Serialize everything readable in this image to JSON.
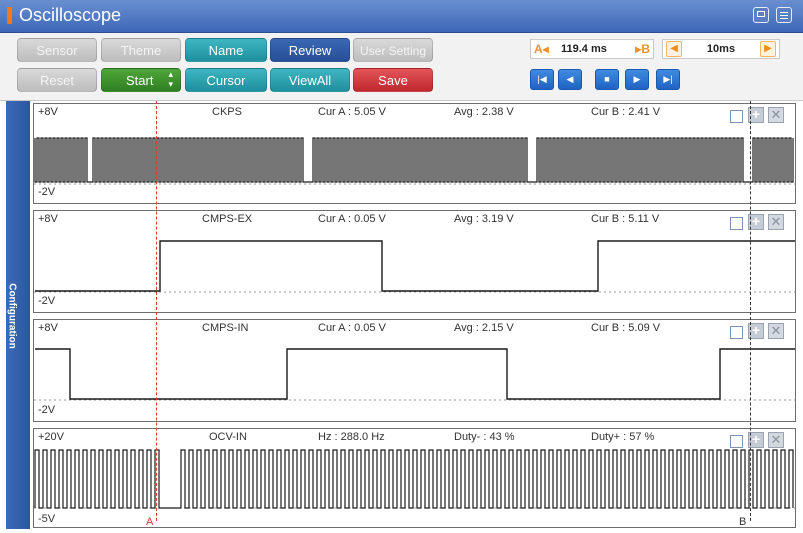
{
  "app": {
    "title": "Oscilloscope"
  },
  "toolbar": {
    "row1": [
      {
        "label": "Sensor",
        "style": "gray"
      },
      {
        "label": "Theme",
        "style": "gray"
      },
      {
        "label": "Name",
        "style": "teal"
      },
      {
        "label": "Review",
        "style": "blue"
      },
      {
        "label": "User Setting",
        "style": "gray"
      }
    ],
    "row2": [
      {
        "label": "Reset",
        "style": "gray"
      },
      {
        "label": "Start",
        "style": "green"
      },
      {
        "label": "Cursor",
        "style": "teal"
      },
      {
        "label": "ViewAll",
        "style": "teal"
      },
      {
        "label": "Save",
        "style": "red"
      }
    ],
    "ab_interval": {
      "a_label": "A◂",
      "value": "119.4 ms",
      "b_label": "▸B"
    },
    "timebase": {
      "value": "10ms",
      "left_arrow": "◀",
      "right_arrow": "▶"
    },
    "nav_buttons": [
      {
        "name": "first",
        "glyph": "|◀"
      },
      {
        "name": "prev",
        "glyph": "◀"
      },
      {
        "name": "stop",
        "glyph": "■"
      },
      {
        "name": "next",
        "glyph": "▶"
      },
      {
        "name": "last",
        "glyph": "▶|"
      }
    ]
  },
  "sidebar": {
    "label": "Configuration"
  },
  "cursors": {
    "a_label": "A",
    "b_label": "B"
  },
  "channels": [
    {
      "id": "ckps",
      "ymax": "+8V",
      "ymin": "-2V",
      "name": "CKPS",
      "m1": "Cur A : 5.05 V",
      "m2": "Avg : 2.38 V",
      "m3": "Cur B : 2.41 V"
    },
    {
      "id": "cmps-ex",
      "ymax": "+8V",
      "ymin": "-2V",
      "name": "CMPS-EX",
      "m1": "Cur A : 0.05 V",
      "m2": "Avg : 3.19 V",
      "m3": "Cur B : 5.11 V"
    },
    {
      "id": "cmps-in",
      "ymax": "+8V",
      "ymin": "-2V",
      "name": "CMPS-IN",
      "m1": "Cur A : 0.05 V",
      "m2": "Avg : 2.15 V",
      "m3": "Cur B : 5.09 V"
    },
    {
      "id": "ocv-in",
      "ymax": "+20V",
      "ymin": "-5V",
      "name": "OCV-IN",
      "m1": "Hz : 288.0 Hz",
      "m2": "Duty- : 43 %",
      "m3": "Duty+ : 57 %"
    }
  ],
  "colors": {
    "title_bar": "#4a73c0",
    "trace": "#1a1a1a",
    "cursor_a": "#e03a3a",
    "cursor_b": "#333333"
  }
}
